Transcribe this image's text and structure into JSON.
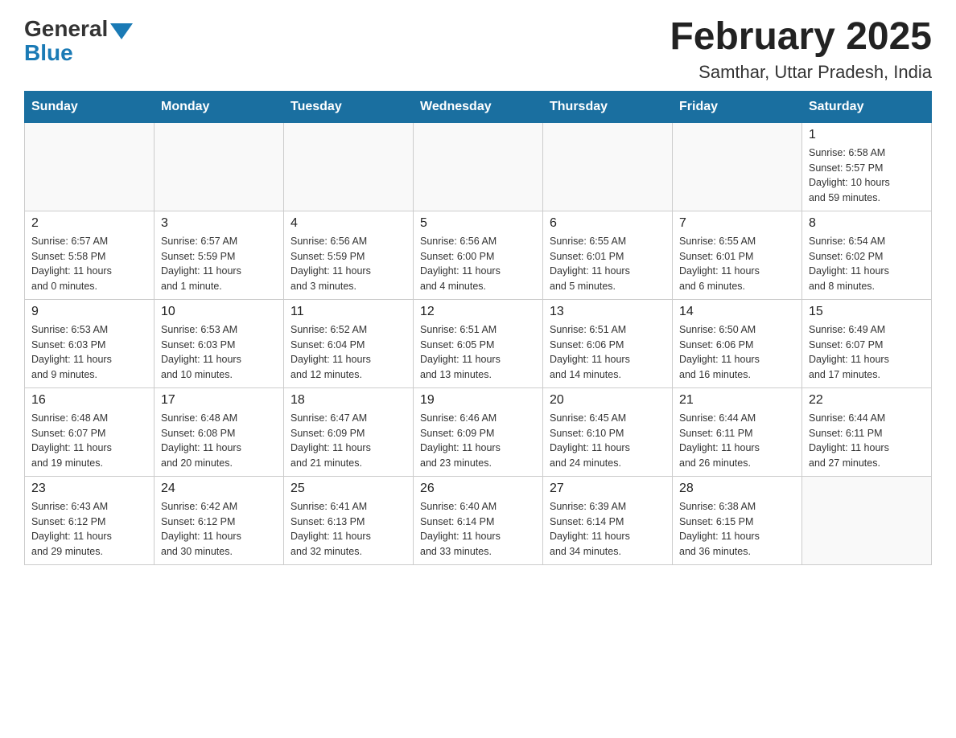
{
  "logo": {
    "general": "General",
    "blue": "Blue"
  },
  "title": "February 2025",
  "subtitle": "Samthar, Uttar Pradesh, India",
  "weekdays": [
    "Sunday",
    "Monday",
    "Tuesday",
    "Wednesday",
    "Thursday",
    "Friday",
    "Saturday"
  ],
  "weeks": [
    [
      {
        "day": "",
        "info": "",
        "empty": true
      },
      {
        "day": "",
        "info": "",
        "empty": true
      },
      {
        "day": "",
        "info": "",
        "empty": true
      },
      {
        "day": "",
        "info": "",
        "empty": true
      },
      {
        "day": "",
        "info": "",
        "empty": true
      },
      {
        "day": "",
        "info": "",
        "empty": true
      },
      {
        "day": "1",
        "info": "Sunrise: 6:58 AM\nSunset: 5:57 PM\nDaylight: 10 hours\nand 59 minutes."
      }
    ],
    [
      {
        "day": "2",
        "info": "Sunrise: 6:57 AM\nSunset: 5:58 PM\nDaylight: 11 hours\nand 0 minutes."
      },
      {
        "day": "3",
        "info": "Sunrise: 6:57 AM\nSunset: 5:59 PM\nDaylight: 11 hours\nand 1 minute."
      },
      {
        "day": "4",
        "info": "Sunrise: 6:56 AM\nSunset: 5:59 PM\nDaylight: 11 hours\nand 3 minutes."
      },
      {
        "day": "5",
        "info": "Sunrise: 6:56 AM\nSunset: 6:00 PM\nDaylight: 11 hours\nand 4 minutes."
      },
      {
        "day": "6",
        "info": "Sunrise: 6:55 AM\nSunset: 6:01 PM\nDaylight: 11 hours\nand 5 minutes."
      },
      {
        "day": "7",
        "info": "Sunrise: 6:55 AM\nSunset: 6:01 PM\nDaylight: 11 hours\nand 6 minutes."
      },
      {
        "day": "8",
        "info": "Sunrise: 6:54 AM\nSunset: 6:02 PM\nDaylight: 11 hours\nand 8 minutes."
      }
    ],
    [
      {
        "day": "9",
        "info": "Sunrise: 6:53 AM\nSunset: 6:03 PM\nDaylight: 11 hours\nand 9 minutes."
      },
      {
        "day": "10",
        "info": "Sunrise: 6:53 AM\nSunset: 6:03 PM\nDaylight: 11 hours\nand 10 minutes."
      },
      {
        "day": "11",
        "info": "Sunrise: 6:52 AM\nSunset: 6:04 PM\nDaylight: 11 hours\nand 12 minutes."
      },
      {
        "day": "12",
        "info": "Sunrise: 6:51 AM\nSunset: 6:05 PM\nDaylight: 11 hours\nand 13 minutes."
      },
      {
        "day": "13",
        "info": "Sunrise: 6:51 AM\nSunset: 6:06 PM\nDaylight: 11 hours\nand 14 minutes."
      },
      {
        "day": "14",
        "info": "Sunrise: 6:50 AM\nSunset: 6:06 PM\nDaylight: 11 hours\nand 16 minutes."
      },
      {
        "day": "15",
        "info": "Sunrise: 6:49 AM\nSunset: 6:07 PM\nDaylight: 11 hours\nand 17 minutes."
      }
    ],
    [
      {
        "day": "16",
        "info": "Sunrise: 6:48 AM\nSunset: 6:07 PM\nDaylight: 11 hours\nand 19 minutes."
      },
      {
        "day": "17",
        "info": "Sunrise: 6:48 AM\nSunset: 6:08 PM\nDaylight: 11 hours\nand 20 minutes."
      },
      {
        "day": "18",
        "info": "Sunrise: 6:47 AM\nSunset: 6:09 PM\nDaylight: 11 hours\nand 21 minutes."
      },
      {
        "day": "19",
        "info": "Sunrise: 6:46 AM\nSunset: 6:09 PM\nDaylight: 11 hours\nand 23 minutes."
      },
      {
        "day": "20",
        "info": "Sunrise: 6:45 AM\nSunset: 6:10 PM\nDaylight: 11 hours\nand 24 minutes."
      },
      {
        "day": "21",
        "info": "Sunrise: 6:44 AM\nSunset: 6:11 PM\nDaylight: 11 hours\nand 26 minutes."
      },
      {
        "day": "22",
        "info": "Sunrise: 6:44 AM\nSunset: 6:11 PM\nDaylight: 11 hours\nand 27 minutes."
      }
    ],
    [
      {
        "day": "23",
        "info": "Sunrise: 6:43 AM\nSunset: 6:12 PM\nDaylight: 11 hours\nand 29 minutes."
      },
      {
        "day": "24",
        "info": "Sunrise: 6:42 AM\nSunset: 6:12 PM\nDaylight: 11 hours\nand 30 minutes."
      },
      {
        "day": "25",
        "info": "Sunrise: 6:41 AM\nSunset: 6:13 PM\nDaylight: 11 hours\nand 32 minutes."
      },
      {
        "day": "26",
        "info": "Sunrise: 6:40 AM\nSunset: 6:14 PM\nDaylight: 11 hours\nand 33 minutes."
      },
      {
        "day": "27",
        "info": "Sunrise: 6:39 AM\nSunset: 6:14 PM\nDaylight: 11 hours\nand 34 minutes."
      },
      {
        "day": "28",
        "info": "Sunrise: 6:38 AM\nSunset: 6:15 PM\nDaylight: 11 hours\nand 36 minutes."
      },
      {
        "day": "",
        "info": "",
        "empty": true
      }
    ]
  ]
}
